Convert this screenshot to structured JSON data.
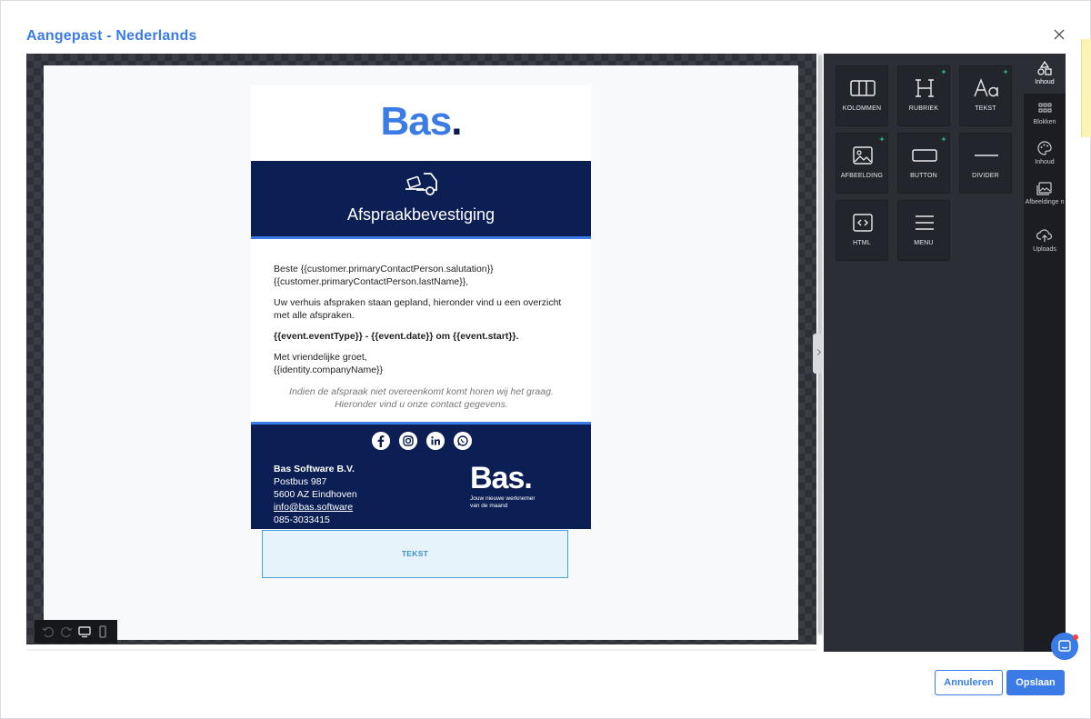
{
  "modal": {
    "title": "Aangepast - Nederlands"
  },
  "email": {
    "logo_text": "Bas",
    "logo_dot": ".",
    "header_title": "Afspraakbevestiging",
    "body": {
      "line1": "Beste {{customer.primaryContactPerson.salutation}} {{customer.primaryContactPerson.lastName}},",
      "line2": "Uw verhuis afspraken staan gepland, hieronder vind u een overzicht met alle afspraken.",
      "line3": "{{event.eventType}} - {{event.date}} om {{event.start}}.",
      "line4a": "Met vriendelijke groet,",
      "line4b": "{{identity.companyName}}",
      "note_a": "Indien de afspraak niet overeenkomt komt horen wij het graag.",
      "note_b": "Hieronder vind u onze contact gegevens."
    },
    "footer": {
      "company": "Bas Software B.V.",
      "address1": "Postbus 987",
      "address2": "5600 AZ Eindhoven",
      "email": "info@bas.software",
      "phone": "085-3033415",
      "logo_text": "Bas.",
      "tagline1": "Jouw nieuwe werknemer",
      "tagline2": "van de maand"
    },
    "social": [
      "facebook-icon",
      "instagram-icon",
      "linkedin-icon",
      "whatsapp-icon"
    ],
    "drop_placeholder": "TEKST"
  },
  "tools": [
    {
      "label": "KOLOMMEN",
      "icon": "columns-icon"
    },
    {
      "label": "RUBRIEK",
      "icon": "heading-icon"
    },
    {
      "label": "TEKST",
      "icon": "text-icon"
    },
    {
      "label": "AFBEELDING",
      "icon": "image-icon"
    },
    {
      "label": "BUTTON",
      "icon": "button-icon"
    },
    {
      "label": "DIVIDER",
      "icon": "divider-icon"
    },
    {
      "label": "HTML",
      "icon": "code-icon"
    },
    {
      "label": "MENU",
      "icon": "menu-icon"
    }
  ],
  "side_tabs": [
    {
      "label": "Inhoud",
      "icon": "shapes-icon"
    },
    {
      "label": "Blokken",
      "icon": "blocks-icon"
    },
    {
      "label": "Inhoud",
      "icon": "palette-icon"
    },
    {
      "label": "Afbeeldinge n",
      "icon": "images-icon"
    },
    {
      "label": "Uploads",
      "icon": "cloud-upload-icon"
    }
  ],
  "buttons": {
    "cancel": "Annuleren",
    "save": "Opslaan"
  },
  "colors": {
    "accent": "#3b7be6",
    "navy": "#0c1f55",
    "panel": "#2b2e35"
  }
}
